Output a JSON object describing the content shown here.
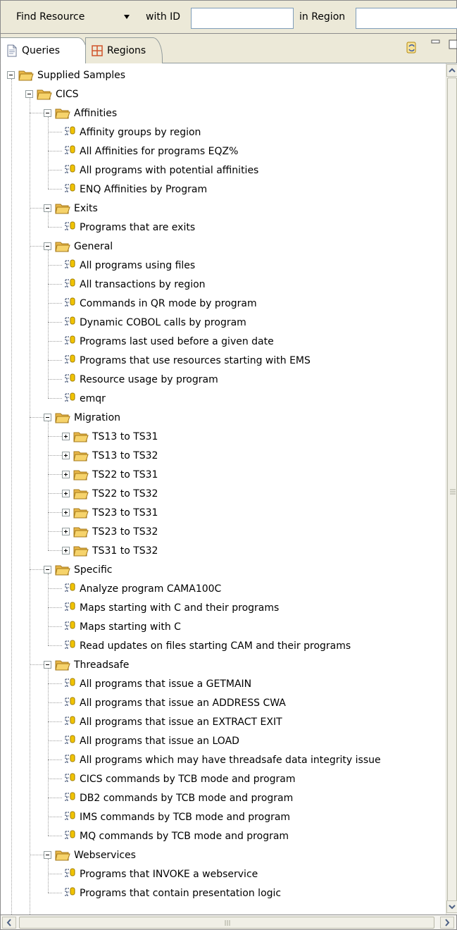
{
  "find_bar": {
    "type_label": "Find Resource",
    "id_label": "with ID",
    "id_value": "",
    "region_label": "in Region",
    "region_value": ""
  },
  "tabs": [
    {
      "label": "Queries",
      "icon": "document-icon",
      "active": true
    },
    {
      "label": "Regions",
      "icon": "grid-icon",
      "active": false
    }
  ],
  "toolbar_icons": [
    "link-with-editor-icon",
    "minimize-icon",
    "maximize-icon"
  ],
  "tree": {
    "root": "Supplied Samples",
    "cics": "CICS",
    "groups": [
      {
        "label": "Affinities",
        "items": [
          "Affinity groups by region",
          "All Affinities for programs EQZ%",
          "All programs with potential affinities",
          "ENQ Affinities by Program"
        ]
      },
      {
        "label": "Exits",
        "items": [
          "Programs that are exits"
        ]
      },
      {
        "label": "General",
        "items": [
          "All programs using files",
          "All transactions by region",
          "Commands in QR mode by program",
          "Dynamic COBOL calls by program",
          "Programs last used before a given date",
          "Programs that use resources starting with EMS",
          "Resource usage by program",
          "emqr"
        ]
      },
      {
        "label": "Migration",
        "folders": [
          "TS13 to TS31",
          "TS13 to TS32",
          "TS22 to TS31",
          "TS22 to TS32",
          "TS23 to TS31",
          "TS23 to TS32",
          "TS31 to TS32"
        ]
      },
      {
        "label": "Specific",
        "items": [
          "Analyze program CAMA100C",
          "Maps starting with C and their programs",
          "Maps starting with C",
          "Read updates on files starting CAM and their programs"
        ]
      },
      {
        "label": "Threadsafe",
        "items": [
          "All programs that issue a GETMAIN",
          "All programs that issue an ADDRESS CWA",
          "All programs that issue an EXTRACT EXIT",
          "All programs that issue an LOAD",
          "All programs which may have threadsafe data integrity issue",
          "CICS commands by TCB mode and program",
          "DB2 commands by TCB mode and program",
          "IMS commands by TCB mode and program",
          "MQ commands by TCB mode and program"
        ]
      },
      {
        "label": "Webservices",
        "items": [
          "Programs that INVOKE a webservice",
          "Programs that contain presentation logic"
        ]
      }
    ]
  },
  "colors": {
    "chrome": "#ece9d8",
    "folder": "#f6d36b",
    "query_icon": "#f2c400",
    "scrollbar_arrow": "#4d6185"
  }
}
